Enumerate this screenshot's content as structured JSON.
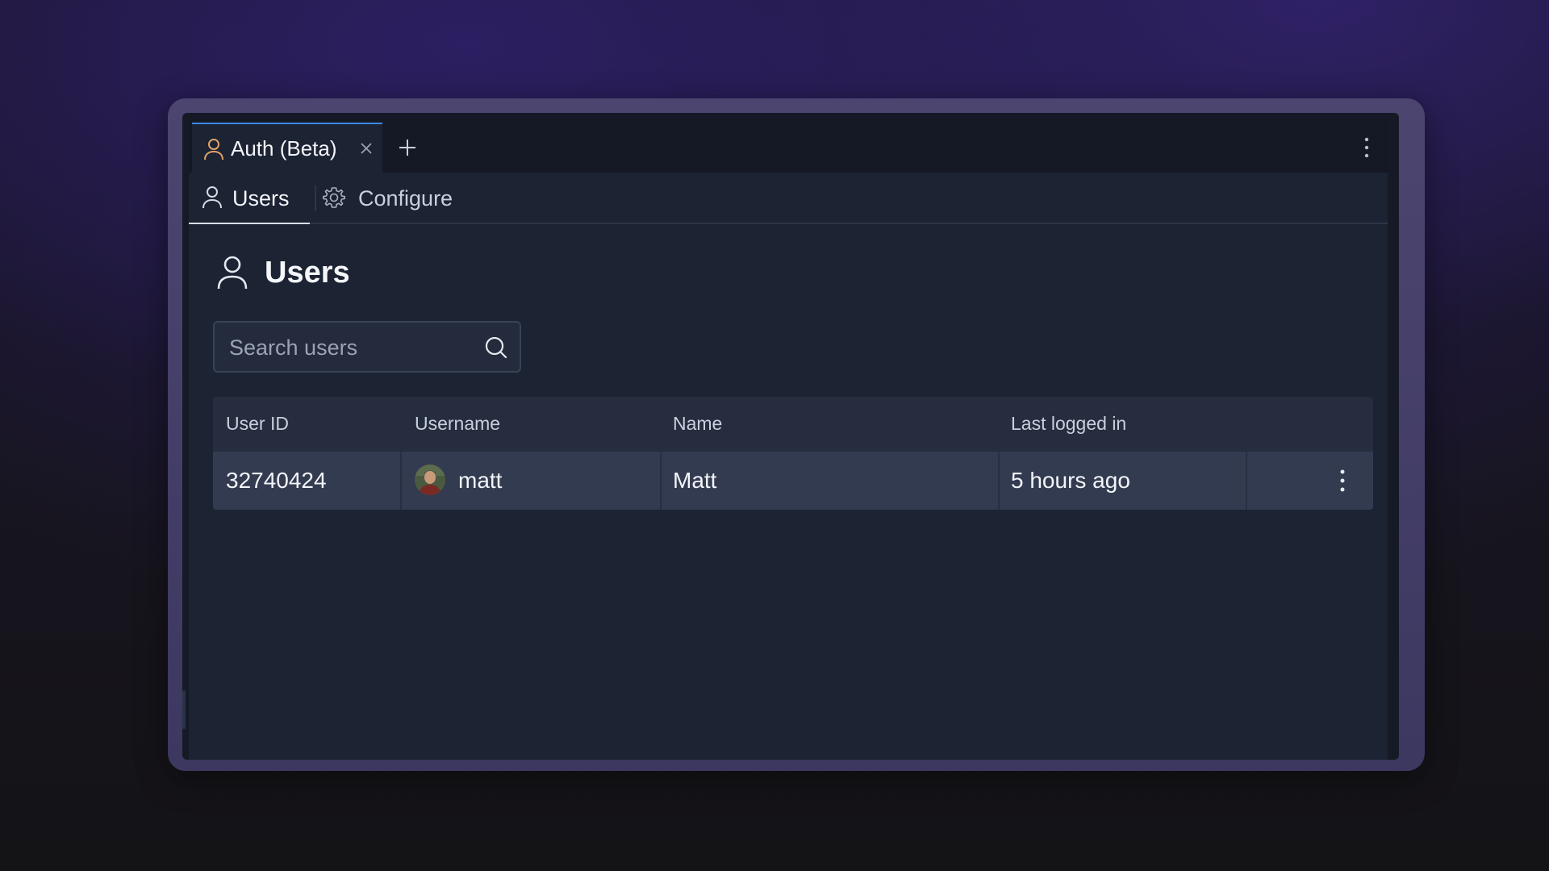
{
  "window": {
    "tab": {
      "label": "Auth (Beta)",
      "icon": "user-icon",
      "close_icon": "close-icon"
    },
    "new_tab_icon": "plus-icon",
    "menu_icon": "kebab-menu-icon"
  },
  "subtabs": [
    {
      "label": "Users",
      "icon": "user-icon",
      "active": true
    },
    {
      "label": "Configure",
      "icon": "gear-icon",
      "active": false
    }
  ],
  "page": {
    "title": "Users",
    "icon": "user-icon"
  },
  "search": {
    "placeholder": "Search users",
    "value": "",
    "icon": "search-icon"
  },
  "table": {
    "columns": [
      "User ID",
      "Username",
      "Name",
      "Last logged in"
    ],
    "rows": [
      {
        "user_id": "32740424",
        "username": "matt",
        "name": "Matt",
        "last_logged_in": "5 hours ago",
        "avatar": "avatar-photo",
        "menu_icon": "kebab-menu-icon"
      }
    ]
  },
  "colors": {
    "active_tab_accent": "#3a89e6",
    "tab_icon": "#e0a36a",
    "window_bg": "#1c2333",
    "row_bg": "#323b50"
  }
}
